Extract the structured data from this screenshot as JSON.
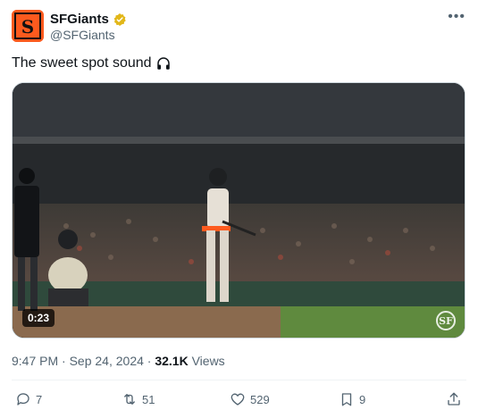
{
  "author": {
    "display_name": "SFGiants",
    "handle": "@SFGiants",
    "verified_color": "#e2b719",
    "brand_color": "#fd5a1e"
  },
  "tweet": {
    "text": "The sweet spot sound",
    "emoji_icon": "headphones-icon"
  },
  "media": {
    "type": "video",
    "duration": "0:23",
    "watermark": "SF"
  },
  "meta": {
    "time": "9:47 PM",
    "separator": "·",
    "date": "Sep 24, 2024",
    "views_count": "32.1K",
    "views_label": "Views"
  },
  "actions": {
    "replies": "7",
    "reposts": "51",
    "likes": "529",
    "bookmarks": "9"
  },
  "icons": [
    "more-icon",
    "reply-icon",
    "repost-icon",
    "like-icon",
    "bookmark-icon",
    "share-icon"
  ]
}
